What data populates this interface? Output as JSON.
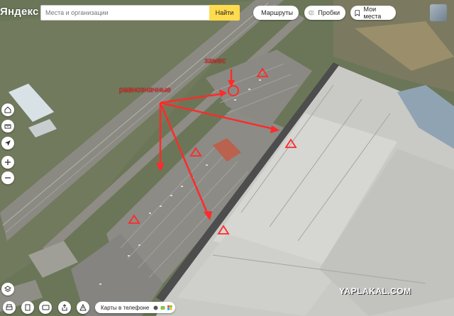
{
  "header": {
    "logo": "Яндекс",
    "search_placeholder": "Места и организации",
    "search_button": "Найти",
    "routes_label": "Маршруты",
    "traffic_label": "Пробки",
    "my_places_label": "Мои места"
  },
  "annotations": {
    "entrance_label": "замес",
    "equivalent_label": "равнозначные"
  },
  "footer": {
    "phone_pill_label": "Карты в телефоне"
  },
  "watermark": "YAPLAKAL.COM",
  "colors": {
    "annotation_red": "#ff2a2a",
    "search_button_yellow": "#ffdb4d"
  },
  "icons": {
    "side_controls": [
      "home-icon",
      "ruler-icon",
      "location-arrow-icon",
      "zoom-in-icon",
      "zoom-out-icon"
    ],
    "bottom_controls": [
      "layers-icon",
      "print-icon",
      "panorama-icon",
      "share-icon",
      "warning-icon"
    ]
  }
}
